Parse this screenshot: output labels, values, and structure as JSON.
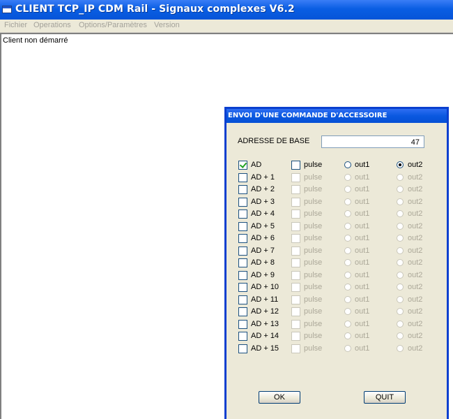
{
  "window": {
    "title": "CLIENT TCP_IP CDM Rail - Signaux complexes V6.2"
  },
  "menu": {
    "items": [
      "Fichier",
      "Operations",
      "Options/Paramètres",
      "Version"
    ]
  },
  "status": {
    "text": "Client non démarré"
  },
  "dialog": {
    "title": "ENVOI D'UNE COMMANDE D'ACCESSOIRE",
    "base_label": "ADRESSE DE BASE",
    "base_value": "47",
    "ok_label": "OK",
    "quit_label": "QUIT",
    "rows": [
      {
        "label": "AD",
        "pulse": "pulse",
        "out1": "out1",
        "out2": "out2",
        "enabled": true,
        "checked": true,
        "pulse_checked": false,
        "selected": "out2"
      },
      {
        "label": "AD + 1",
        "pulse": "pulse",
        "out1": "out1",
        "out2": "out2",
        "enabled": false,
        "checked": false,
        "pulse_checked": false,
        "selected": ""
      },
      {
        "label": "AD + 2",
        "pulse": "pulse",
        "out1": "out1",
        "out2": "out2",
        "enabled": false,
        "checked": false,
        "pulse_checked": false,
        "selected": ""
      },
      {
        "label": "AD + 3",
        "pulse": "pulse",
        "out1": "out1",
        "out2": "out2",
        "enabled": false,
        "checked": false,
        "pulse_checked": false,
        "selected": ""
      },
      {
        "label": "AD + 4",
        "pulse": "pulse",
        "out1": "out1",
        "out2": "out2",
        "enabled": false,
        "checked": false,
        "pulse_checked": false,
        "selected": ""
      },
      {
        "label": "AD + 5",
        "pulse": "pulse",
        "out1": "out1",
        "out2": "out2",
        "enabled": false,
        "checked": false,
        "pulse_checked": false,
        "selected": ""
      },
      {
        "label": "AD + 6",
        "pulse": "pulse",
        "out1": "out1",
        "out2": "out2",
        "enabled": false,
        "checked": false,
        "pulse_checked": false,
        "selected": ""
      },
      {
        "label": "AD + 7",
        "pulse": "pulse",
        "out1": "out1",
        "out2": "out2",
        "enabled": false,
        "checked": false,
        "pulse_checked": false,
        "selected": ""
      },
      {
        "label": "AD + 8",
        "pulse": "pulse",
        "out1": "out1",
        "out2": "out2",
        "enabled": false,
        "checked": false,
        "pulse_checked": false,
        "selected": ""
      },
      {
        "label": "AD + 9",
        "pulse": "pulse",
        "out1": "out1",
        "out2": "out2",
        "enabled": false,
        "checked": false,
        "pulse_checked": false,
        "selected": ""
      },
      {
        "label": "AD + 10",
        "pulse": "pulse",
        "out1": "out1",
        "out2": "out2",
        "enabled": false,
        "checked": false,
        "pulse_checked": false,
        "selected": ""
      },
      {
        "label": "AD + 11",
        "pulse": "pulse",
        "out1": "out1",
        "out2": "out2",
        "enabled": false,
        "checked": false,
        "pulse_checked": false,
        "selected": ""
      },
      {
        "label": "AD + 12",
        "pulse": "pulse",
        "out1": "out1",
        "out2": "out2",
        "enabled": false,
        "checked": false,
        "pulse_checked": false,
        "selected": ""
      },
      {
        "label": "AD + 13",
        "pulse": "pulse",
        "out1": "out1",
        "out2": "out2",
        "enabled": false,
        "checked": false,
        "pulse_checked": false,
        "selected": ""
      },
      {
        "label": "AD + 14",
        "pulse": "pulse",
        "out1": "out1",
        "out2": "out2",
        "enabled": false,
        "checked": false,
        "pulse_checked": false,
        "selected": ""
      },
      {
        "label": "AD + 15",
        "pulse": "pulse",
        "out1": "out1",
        "out2": "out2",
        "enabled": false,
        "checked": false,
        "pulse_checked": false,
        "selected": ""
      }
    ]
  }
}
